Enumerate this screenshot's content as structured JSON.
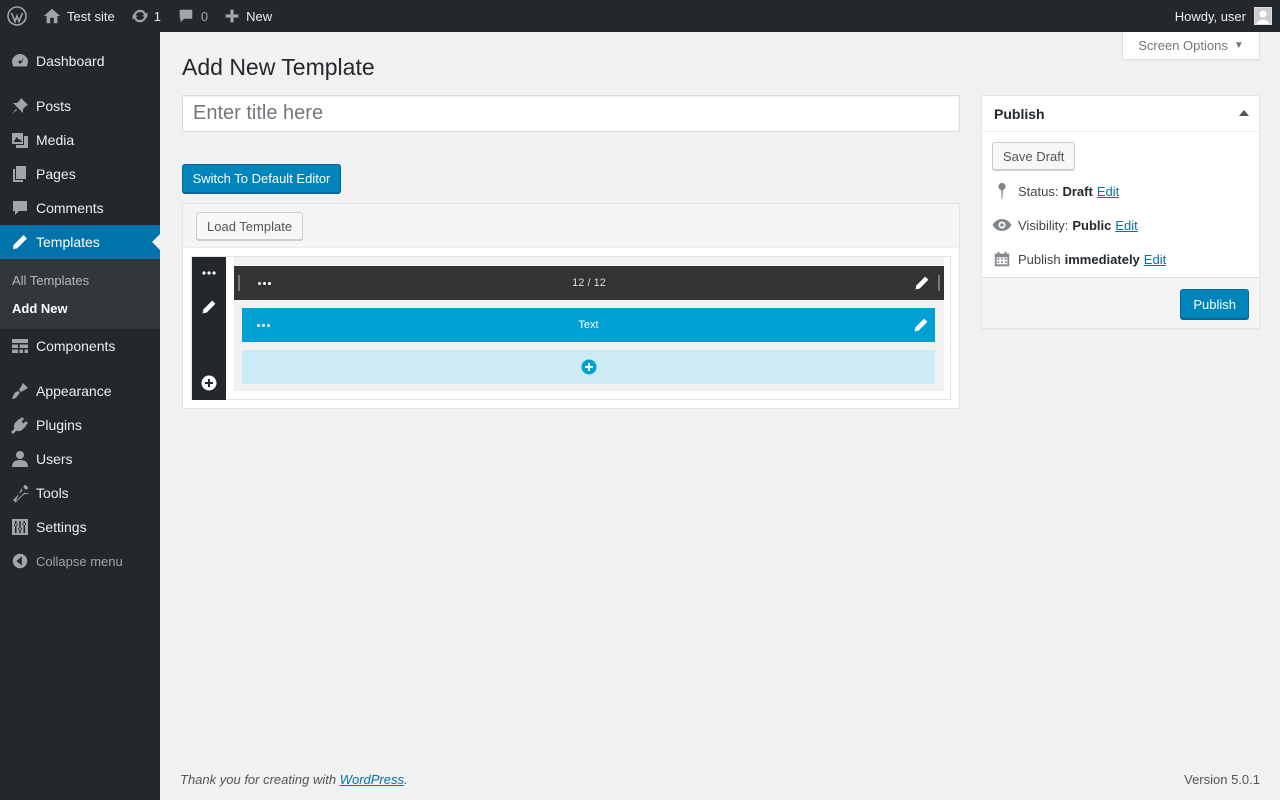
{
  "adminbar": {
    "site_name": "Test site",
    "updates_count": "1",
    "comments_count": "0",
    "new_label": "New",
    "howdy": "Howdy, user"
  },
  "sidebar": {
    "items": [
      {
        "label": "Dashboard",
        "icon": "dashboard-icon"
      },
      {
        "label": "Posts",
        "icon": "pin-icon"
      },
      {
        "label": "Media",
        "icon": "media-icon"
      },
      {
        "label": "Pages",
        "icon": "pages-icon"
      },
      {
        "label": "Comments",
        "icon": "comment-icon"
      },
      {
        "label": "Templates",
        "icon": "pencil-icon"
      },
      {
        "label": "Components",
        "icon": "grid-icon"
      },
      {
        "label": "Appearance",
        "icon": "brush-icon"
      },
      {
        "label": "Plugins",
        "icon": "plug-icon"
      },
      {
        "label": "Users",
        "icon": "user-icon"
      },
      {
        "label": "Tools",
        "icon": "wrench-icon"
      },
      {
        "label": "Settings",
        "icon": "sliders-icon"
      }
    ],
    "submenu": [
      "All Templates",
      "Add New"
    ],
    "collapse_label": "Collapse menu"
  },
  "screen_options": "Screen Options",
  "page_title": "Add New Template",
  "title_placeholder": "Enter title here",
  "switch_editor_label": "Switch To Default Editor",
  "builder": {
    "load_template_label": "Load Template",
    "row_label": "12 / 12",
    "text_block_label": "Text"
  },
  "publish": {
    "title": "Publish",
    "save_draft": "Save Draft",
    "status_label": "Status:",
    "status_value": "Draft",
    "visibility_label": "Visibility:",
    "visibility_value": "Public",
    "publish_label": "Publish",
    "publish_value": "immediately",
    "edit_label": "Edit",
    "publish_button": "Publish"
  },
  "footer": {
    "thanks_prefix": "Thank you for creating with ",
    "thanks_link": "WordPress",
    "thanks_suffix": ".",
    "version": "Version 5.0.1"
  },
  "colors": {
    "accent": "#0073aa",
    "primary_button": "#0085ba",
    "admin_dark": "#23282d",
    "text_block": "#00a0d2",
    "add_block": "#cdebf5"
  }
}
